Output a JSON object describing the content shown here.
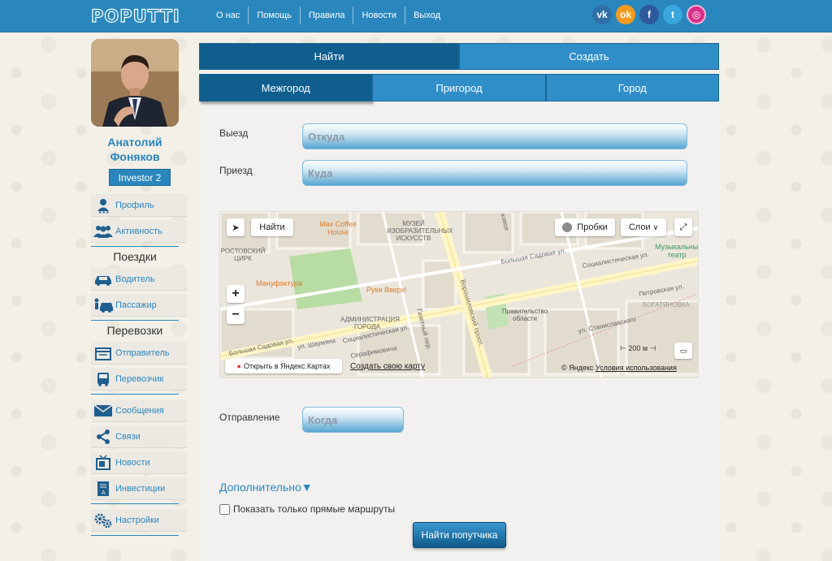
{
  "header": {
    "logo": "POPUTTI",
    "nav": [
      "О нас",
      "Помощь",
      "Правила",
      "Новости",
      "Выход"
    ],
    "social": [
      {
        "name": "vk-icon",
        "glyph": "vk",
        "color": "#2f6ea6"
      },
      {
        "name": "odnoklassniki-icon",
        "glyph": "ok",
        "color": "#f29a1f"
      },
      {
        "name": "facebook-icon",
        "glyph": "f",
        "color": "#2e5a9c"
      },
      {
        "name": "twitter-icon",
        "glyph": "t",
        "color": "#39a6de"
      },
      {
        "name": "instagram-icon",
        "glyph": "◎",
        "color": "#d6308a"
      }
    ]
  },
  "user": {
    "first_name": "Анатолий",
    "last_name": "Фоняков",
    "badge": "Investor 2"
  },
  "sidebar": {
    "profile": "Профиль",
    "activity": "Активность",
    "trips_title": "Поездки",
    "driver": "Водитель",
    "passenger": "Пассажир",
    "cargo_title": "Перевозки",
    "sender": "Отправитель",
    "carrier": "Перевозчик",
    "messages": "Сообщения",
    "connections": "Связи",
    "news": "Новости",
    "investments": "Инвестиции",
    "settings": "Настройки"
  },
  "tabs": {
    "find": "Найти",
    "create": "Создать",
    "intercity": "Межгород",
    "suburb": "Пригород",
    "city": "Город"
  },
  "form": {
    "departure_label": "Выезд",
    "departure_placeholder": "Откуда",
    "arrival_label": "Приезд",
    "arrival_placeholder": "Куда",
    "when_label": "Отправление",
    "when_placeholder": "Когда",
    "more": "Дополнительно▼",
    "direct_only": "Показать только прямые маршруты",
    "submit": "Найти попутчика"
  },
  "map": {
    "find_btn": "Найти",
    "traffic_btn": "Пробки",
    "layers_btn": "Слои",
    "open_yandex": "Открыть в Яндекс.Картах",
    "create_map": "Создать свою карту",
    "copyright": "© Яндекс",
    "terms": "Условия использования",
    "scale": "200 м",
    "streets": {
      "bolshaya_sadovaya_top": "Большая Садовая ул.",
      "bolshaya_sadovaya_left": "Большая Садовая ул.",
      "voroshilovsky": "Ворошиловский просп.",
      "socialist": "Социалистическая ул.",
      "petrovskaya": "Петровская ул.",
      "stanislavskogo": "ул. Станиславского",
      "shaumyana": "ул. Шаумяна",
      "socialist_left": "Социалистическая ул.",
      "serafimovicha": "Серафимовича",
      "gazetny": "Газетный пер.",
      "koshevogo": "ковоя"
    },
    "pois": {
      "max_coffee": "Max Coffee House",
      "manufaktura": "Мануфактура",
      "ruki_vverh": "Руки Вверх!",
      "museum": "МУЗЕЙ ИЗОБРАЗИТЕЛЬНЫХ ИСКУССТВ",
      "circus": "РОСТОВСКИЙ ЦИРК",
      "admin": "АДМИНИСТРАЦИЯ ГОРОДА",
      "government": "Правительство области",
      "theatre": "Музыкальный театр",
      "bogatyanovka": "БОГАТЯНОВКА"
    }
  }
}
